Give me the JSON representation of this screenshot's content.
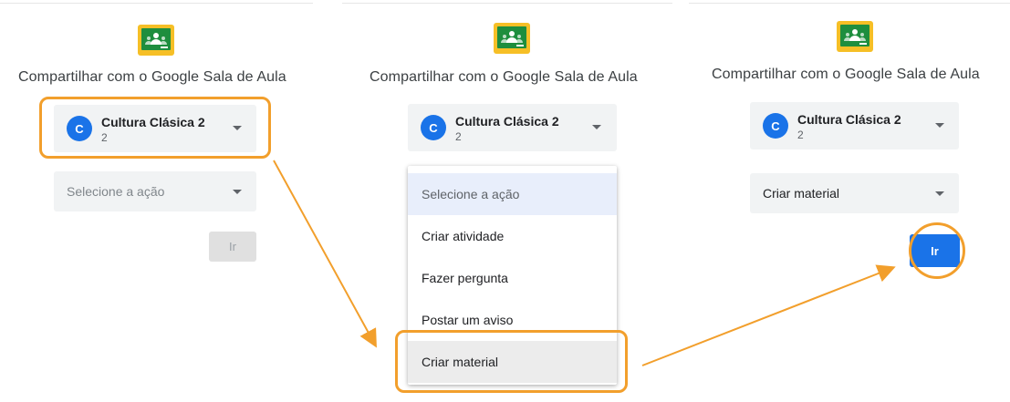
{
  "panels": [
    {
      "title": "Compartilhar com o Google Sala de Aula",
      "class_avatar_letter": "C",
      "class_name": "Cultura Clásica 2",
      "class_section": "2",
      "action_placeholder": "Selecione a ação",
      "go_button": "Ir",
      "go_button_state": "disabled"
    },
    {
      "title": "Compartilhar com o Google Sala de Aula",
      "class_avatar_letter": "C",
      "class_name": "Cultura Clásica 2",
      "class_section": "2",
      "menu_items": [
        "Selecione a ação",
        "Criar atividade",
        "Fazer pergunta",
        "Postar um aviso",
        "Criar material"
      ],
      "menu_selected": "Criar material"
    },
    {
      "title": "Compartilhar com o Google Sala de Aula",
      "class_avatar_letter": "C",
      "class_name": "Cultura Clásica 2",
      "class_section": "2",
      "action_value": "Criar material",
      "go_button": "Ir",
      "go_button_state": "enabled"
    }
  ],
  "colors": {
    "accent_blue": "#1a73e8",
    "callout_orange": "#f29f2c",
    "select_bg": "#f1f3f4",
    "logo_yellow": "#f6bf26",
    "logo_green": "#1e8e3e"
  },
  "icons": [
    "google-classroom-logo-icon",
    "chevron-down-icon",
    "arrow-icon"
  ]
}
